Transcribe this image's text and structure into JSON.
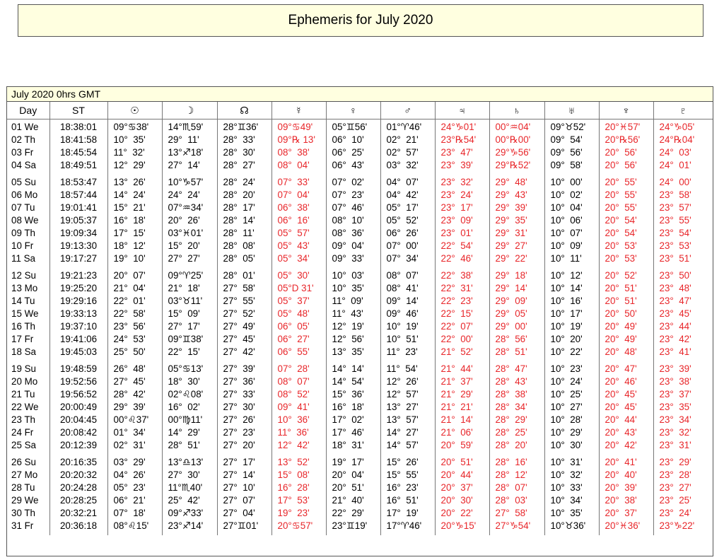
{
  "page_title": "Ephemeris for July 2020",
  "table_title": "July 2020  0hrs GMT",
  "columns": [
    {
      "key": "day",
      "label": "Day",
      "name": "day",
      "red": false
    },
    {
      "key": "st",
      "label": "ST",
      "name": "sidereal-time",
      "red": false
    },
    {
      "key": "sun",
      "label": "☉",
      "name": "sun-icon",
      "red": false
    },
    {
      "key": "moon",
      "label": "☽",
      "name": "moon-icon",
      "red": false
    },
    {
      "key": "node",
      "label": "☊",
      "name": "node-icon",
      "red": false
    },
    {
      "key": "mercury",
      "label": "☿",
      "name": "mercury-icon",
      "red": true
    },
    {
      "key": "venus",
      "label": "♀",
      "name": "venus-icon",
      "red": false
    },
    {
      "key": "mars",
      "label": "♂",
      "name": "mars-icon",
      "red": false
    },
    {
      "key": "jupiter",
      "label": "♃",
      "name": "jupiter-icon",
      "red": true
    },
    {
      "key": "saturn",
      "label": "♄",
      "name": "saturn-icon",
      "red": true
    },
    {
      "key": "uranus",
      "label": "♅",
      "name": "uranus-icon",
      "red": false
    },
    {
      "key": "neptune",
      "label": "♆",
      "name": "neptune-icon",
      "red": true
    },
    {
      "key": "pluto",
      "label": "♇",
      "name": "pluto-icon",
      "red": true
    }
  ],
  "red_color": "#e8262a",
  "weeks": [
    {
      "day": [
        "01 We",
        "02 Th",
        "03 Fr",
        "04 Sa"
      ],
      "st": [
        "18:38:01",
        "18:41:58",
        "18:45:54",
        "18:49:51"
      ],
      "sun": [
        "09°♋38'",
        "10°  35'",
        "11°  32'",
        "12°  29'"
      ],
      "moon": [
        "14°♏59'",
        "29°  11'",
        "13°♐18'",
        "27°  14'"
      ],
      "node": [
        "28°♊36'",
        "28°  33'",
        "28°  30'",
        "28°  27'"
      ],
      "mercury": [
        "09°♋49'",
        "09°℞ 13'",
        "08°  38'",
        "08°  04'"
      ],
      "venus": [
        "05°♊56'",
        "06°  10'",
        "06°  25'",
        "06°  43'"
      ],
      "mars": [
        "01°♈46'",
        "02°  21'",
        "02°  57'",
        "03°  32'"
      ],
      "jupiter": [
        "24°♑01'",
        "23°℞54'",
        "23°  47'",
        "23°  39'"
      ],
      "saturn": [
        "00°♒04'",
        "00°℞00'",
        "29°♑56'",
        "29°℞52'"
      ],
      "uranus": [
        "09°♉52'",
        "09°  54'",
        "09°  56'",
        "09°  58'"
      ],
      "neptune": [
        "20°♓57'",
        "20°℞56'",
        "20°  56'",
        "20°  56'"
      ],
      "pluto": [
        "24°♑05'",
        "24°℞04'",
        "24°  03'",
        "24°  01'"
      ]
    },
    {
      "day": [
        "05 Su",
        "06 Mo",
        "07 Tu",
        "08 We",
        "09 Th",
        "10 Fr",
        "11 Sa"
      ],
      "st": [
        "18:53:47",
        "18:57:44",
        "19:01:41",
        "19:05:37",
        "19:09:34",
        "19:13:30",
        "19:17:27"
      ],
      "sun": [
        "13°  26'",
        "14°  24'",
        "15°  21'",
        "16°  18'",
        "17°  15'",
        "18°  12'",
        "19°  10'"
      ],
      "moon": [
        "10°♑57'",
        "24°  24'",
        "07°♒34'",
        "20°  26'",
        "03°♓01'",
        "15°  20'",
        "27°  27'"
      ],
      "node": [
        "28°  24'",
        "28°  20'",
        "28°  17'",
        "28°  14'",
        "28°  11'",
        "28°  08'",
        "28°  05'"
      ],
      "mercury": [
        "07°  33'",
        "07°  04'",
        "06°  38'",
        "06°  16'",
        "05°  57'",
        "05°  43'",
        "05°  34'"
      ],
      "venus": [
        "07°  02'",
        "07°  23'",
        "07°  46'",
        "08°  10'",
        "08°  36'",
        "09°  04'",
        "09°  33'"
      ],
      "mars": [
        "04°  07'",
        "04°  42'",
        "05°  17'",
        "05°  52'",
        "06°  26'",
        "07°  00'",
        "07°  34'"
      ],
      "jupiter": [
        "23°  32'",
        "23°  24'",
        "23°  17'",
        "23°  09'",
        "23°  01'",
        "22°  54'",
        "22°  46'"
      ],
      "saturn": [
        "29°  48'",
        "29°  43'",
        "29°  39'",
        "29°  35'",
        "29°  31'",
        "29°  27'",
        "29°  22'"
      ],
      "uranus": [
        "10°  00'",
        "10°  02'",
        "10°  04'",
        "10°  06'",
        "10°  07'",
        "10°  09'",
        "10°  11'"
      ],
      "neptune": [
        "20°  55'",
        "20°  55'",
        "20°  55'",
        "20°  54'",
        "20°  54'",
        "20°  53'",
        "20°  53'"
      ],
      "pluto": [
        "24°  00'",
        "23°  58'",
        "23°  57'",
        "23°  55'",
        "23°  54'",
        "23°  53'",
        "23°  51'"
      ]
    },
    {
      "day": [
        "12 Su",
        "13 Mo",
        "14 Tu",
        "15 We",
        "16 Th",
        "17 Fr",
        "18 Sa"
      ],
      "st": [
        "19:21:23",
        "19:25:20",
        "19:29:16",
        "19:33:13",
        "19:37:10",
        "19:41:06",
        "19:45:03"
      ],
      "sun": [
        "20°  07'",
        "21°  04'",
        "22°  01'",
        "22°  58'",
        "23°  56'",
        "24°  53'",
        "25°  50'"
      ],
      "moon": [
        "09°♈25'",
        "21°  18'",
        "03°♉11'",
        "15°  09'",
        "27°  17'",
        "09°♊38'",
        "22°  15'"
      ],
      "node": [
        "28°  01'",
        "27°  58'",
        "27°  55'",
        "27°  52'",
        "27°  49'",
        "27°  45'",
        "27°  42'"
      ],
      "mercury": [
        "05°  30'",
        "05°D 31'",
        "05°  37'",
        "05°  48'",
        "06°  05'",
        "06°  27'",
        "06°  55'"
      ],
      "venus": [
        "10°  03'",
        "10°  35'",
        "11°  09'",
        "11°  43'",
        "12°  19'",
        "12°  56'",
        "13°  35'"
      ],
      "mars": [
        "08°  07'",
        "08°  41'",
        "09°  14'",
        "09°  46'",
        "10°  19'",
        "10°  51'",
        "11°  23'"
      ],
      "jupiter": [
        "22°  38'",
        "22°  31'",
        "22°  23'",
        "22°  15'",
        "22°  07'",
        "22°  00'",
        "21°  52'"
      ],
      "saturn": [
        "29°  18'",
        "29°  14'",
        "29°  09'",
        "29°  05'",
        "29°  00'",
        "28°  56'",
        "28°  51'"
      ],
      "uranus": [
        "10°  12'",
        "10°  14'",
        "10°  16'",
        "10°  17'",
        "10°  19'",
        "10°  20'",
        "10°  22'"
      ],
      "neptune": [
        "20°  52'",
        "20°  51'",
        "20°  51'",
        "20°  50'",
        "20°  49'",
        "20°  49'",
        "20°  48'"
      ],
      "pluto": [
        "23°  50'",
        "23°  48'",
        "23°  47'",
        "23°  45'",
        "23°  44'",
        "23°  42'",
        "23°  41'"
      ]
    },
    {
      "day": [
        "19 Su",
        "20 Mo",
        "21 Tu",
        "22 We",
        "23 Th",
        "24 Fr",
        "25 Sa"
      ],
      "st": [
        "19:48:59",
        "19:52:56",
        "19:56:52",
        "20:00:49",
        "20:04:45",
        "20:08:42",
        "20:12:39"
      ],
      "sun": [
        "26°  48'",
        "27°  45'",
        "28°  42'",
        "29°  39'",
        "00°♌37'",
        "01°  34'",
        "02°  31'"
      ],
      "moon": [
        "05°♋13'",
        "18°  30'",
        "02°♌08'",
        "16°  02'",
        "00°♍11'",
        "14°  29'",
        "28°  51'"
      ],
      "node": [
        "27°  39'",
        "27°  36'",
        "27°  33'",
        "27°  30'",
        "27°  26'",
        "27°  23'",
        "27°  20'"
      ],
      "mercury": [
        "07°  28'",
        "08°  07'",
        "08°  52'",
        "09°  41'",
        "10°  36'",
        "11°  36'",
        "12°  42'"
      ],
      "venus": [
        "14°  14'",
        "14°  54'",
        "15°  36'",
        "16°  18'",
        "17°  02'",
        "17°  46'",
        "18°  31'"
      ],
      "mars": [
        "11°  54'",
        "12°  26'",
        "12°  57'",
        "13°  27'",
        "13°  57'",
        "14°  27'",
        "14°  57'"
      ],
      "jupiter": [
        "21°  44'",
        "21°  37'",
        "21°  29'",
        "21°  21'",
        "21°  14'",
        "21°  06'",
        "20°  59'"
      ],
      "saturn": [
        "28°  47'",
        "28°  43'",
        "28°  38'",
        "28°  34'",
        "28°  29'",
        "28°  25'",
        "28°  20'"
      ],
      "uranus": [
        "10°  23'",
        "10°  24'",
        "10°  25'",
        "10°  27'",
        "10°  28'",
        "10°  29'",
        "10°  30'"
      ],
      "neptune": [
        "20°  47'",
        "20°  46'",
        "20°  45'",
        "20°  45'",
        "20°  44'",
        "20°  43'",
        "20°  42'"
      ],
      "pluto": [
        "23°  39'",
        "23°  38'",
        "23°  37'",
        "23°  35'",
        "23°  34'",
        "23°  32'",
        "23°  31'"
      ]
    },
    {
      "day": [
        "26 Su",
        "27 Mo",
        "28 Tu",
        "29 We",
        "30 Th",
        "31 Fr"
      ],
      "st": [
        "20:16:35",
        "20:20:32",
        "20:24:28",
        "20:28:25",
        "20:32:21",
        "20:36:18"
      ],
      "sun": [
        "03°  29'",
        "04°  26'",
        "05°  23'",
        "06°  21'",
        "07°  18'",
        "08°♌15'"
      ],
      "moon": [
        "13°♎13'",
        "27°  30'",
        "11°♏40'",
        "25°  42'",
        "09°♐33'",
        "23°♐14'"
      ],
      "node": [
        "27°  17'",
        "27°  14'",
        "27°  10'",
        "27°  07'",
        "27°  04'",
        "27°♊01'"
      ],
      "mercury": [
        "13°  52'",
        "15°  08'",
        "16°  28'",
        "17°  53'",
        "19°  23'",
        "20°♋57'"
      ],
      "venus": [
        "19°  17'",
        "20°  04'",
        "20°  51'",
        "21°  40'",
        "22°  29'",
        "23°♊19'"
      ],
      "mars": [
        "15°  26'",
        "15°  55'",
        "16°  23'",
        "16°  51'",
        "17°  19'",
        "17°♈46'"
      ],
      "jupiter": [
        "20°  51'",
        "20°  44'",
        "20°  37'",
        "20°  30'",
        "20°  22'",
        "20°♑15'"
      ],
      "saturn": [
        "28°  16'",
        "28°  12'",
        "28°  07'",
        "28°  03'",
        "27°  58'",
        "27°♑54'"
      ],
      "uranus": [
        "10°  31'",
        "10°  32'",
        "10°  33'",
        "10°  34'",
        "10°  35'",
        "10°♉36'"
      ],
      "neptune": [
        "20°  41'",
        "20°  40'",
        "20°  39'",
        "20°  38'",
        "20°  37'",
        "20°♓36'"
      ],
      "pluto": [
        "23°  29'",
        "23°  28'",
        "23°  27'",
        "23°  25'",
        "23°  24'",
        "23°♑22'"
      ]
    }
  ]
}
